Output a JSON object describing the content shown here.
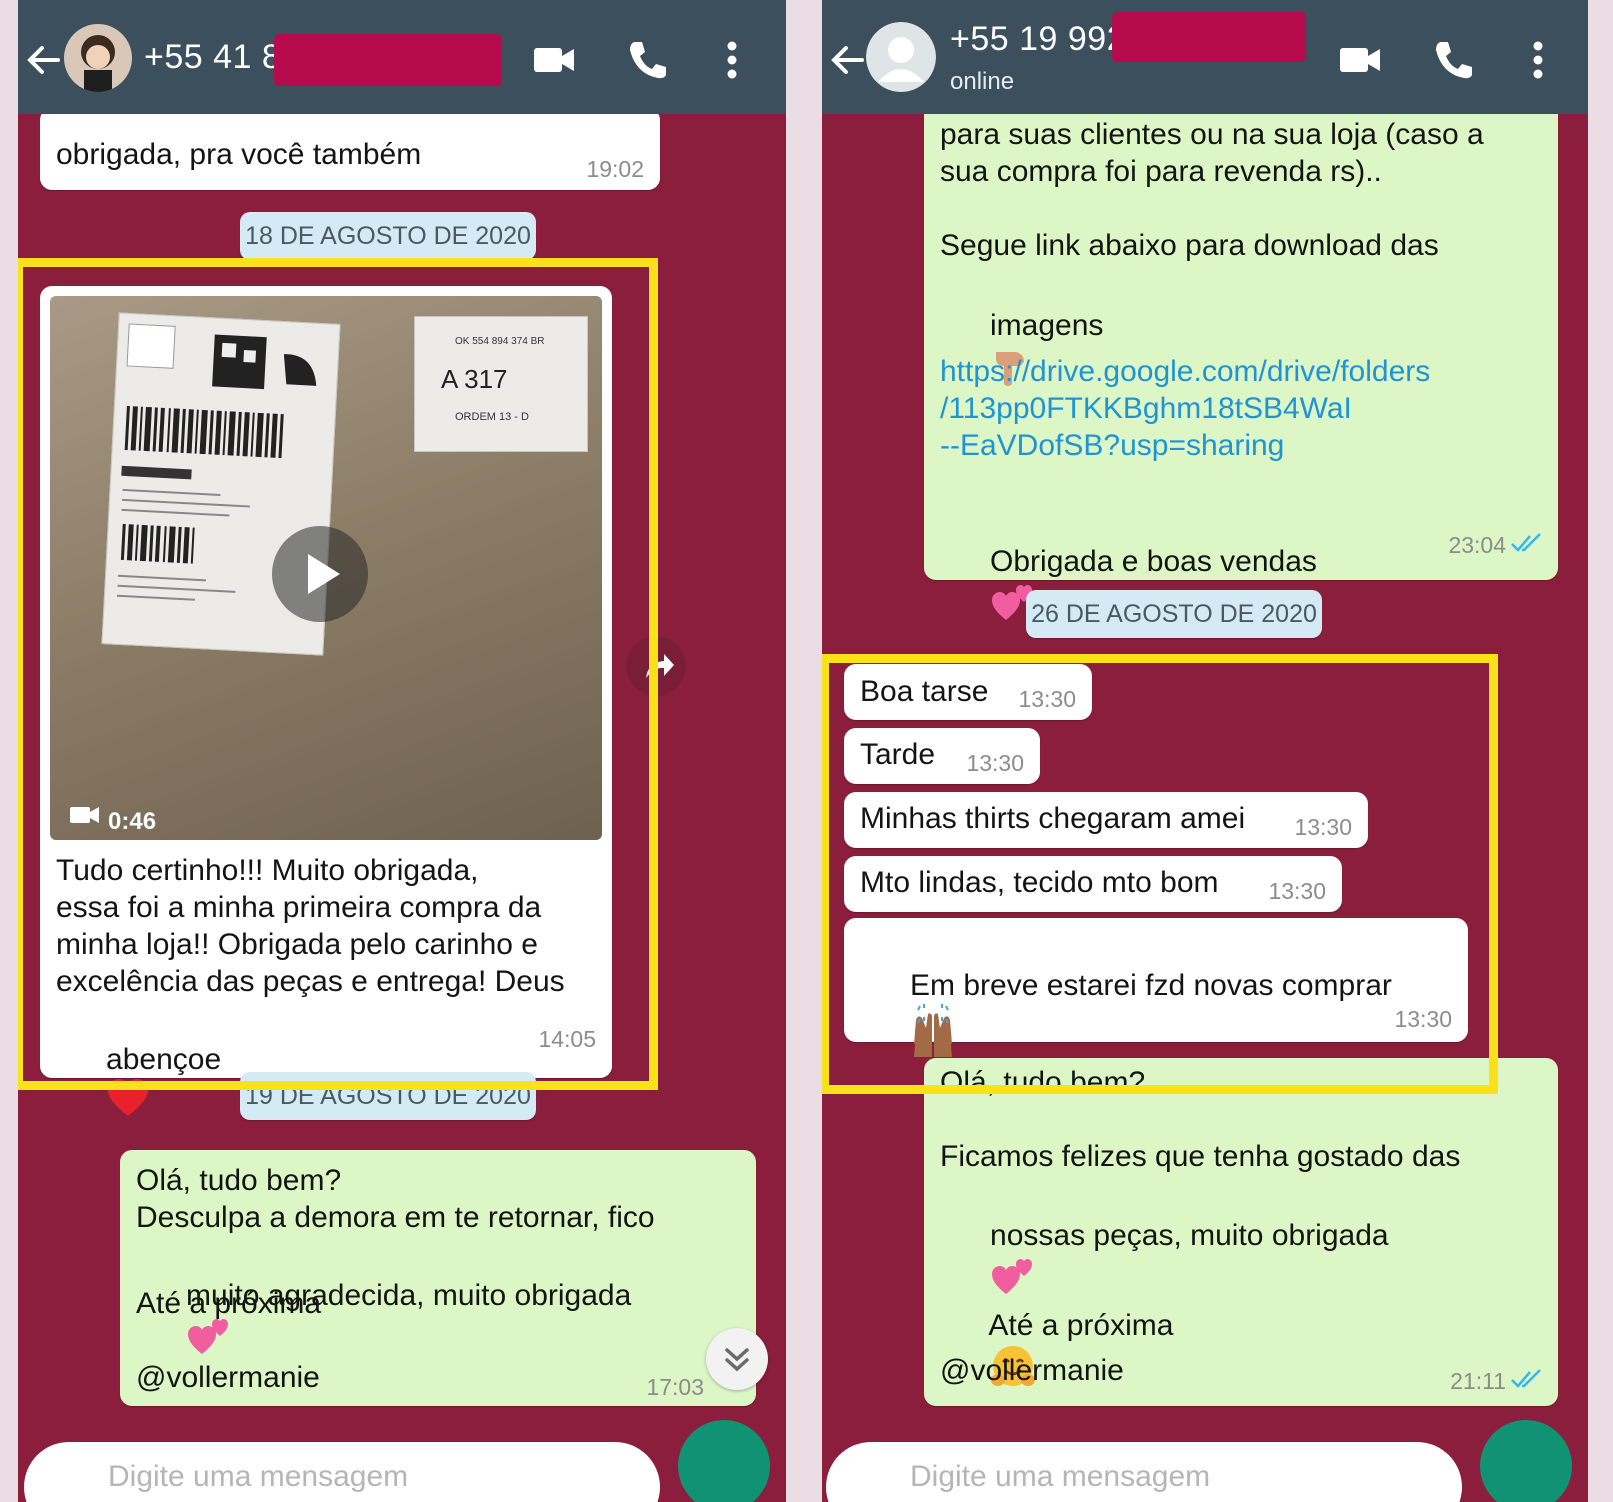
{
  "colors": {
    "chat_background": "#8b1e3c",
    "header": "#3b4f5c",
    "incoming_bubble": "#ffffff",
    "outgoing_bubble": "#dcf7c5",
    "date_pill": "#d4eaf4",
    "highlight_box": "#f9e21a",
    "redaction": "#b60c4d",
    "link": "#1f93d4",
    "mic_button": "#119273"
  },
  "left_chat": {
    "header": {
      "contact_name": "+55 41 8",
      "icons": [
        "back-arrow-icon",
        "avatar",
        "video-call-icon",
        "phone-icon",
        "more-options-icon"
      ]
    },
    "messages": {
      "m1_text": "obrigada, pra você também",
      "m1_time": "19:02",
      "date1": "18 DE AGOSTO DE 2020",
      "video_duration": "0:46",
      "video_label": {
        "a": "A   317",
        "ordem": "ORDEM  13 - D",
        "code": "OK 554 894 374 BR"
      },
      "m2_line1": "Tudo certinho!!! Muito obrigada,",
      "m2_line2": "essa foi a minha primeira compra da",
      "m2_line3": "minha loja!! Obrigada pelo carinho e",
      "m2_line4": "excelência das peças e entrega! Deus",
      "m2_line5": "abençoe",
      "m2_time": "14:05",
      "date2": "19 DE AGOSTO DE 2020",
      "m3_line1": "Olá, tudo bem?",
      "m3_line2": "Desculpa a demora em te retornar, fico",
      "m3_line3": "muito agradecida, muito obrigada",
      "m3_line4": "Até a próxima",
      "m3_line5": "@vollermanie",
      "m3_time": "17:03"
    },
    "input_placeholder": "Digite uma mensagem"
  },
  "right_chat": {
    "header": {
      "contact_name": "+55 19 992",
      "status": "online"
    },
    "messages": {
      "m1_line1": "para suas clientes ou na sua loja (caso a",
      "m1_line2": "sua compra foi para revenda rs)..",
      "m1_line3": "Segue link abaixo para download das",
      "m1_line4": "imagens",
      "m1_link1": "https://drive.google.com/drive/folders",
      "m1_link2": "/113pp0FTKKBghm18tSB4WaI",
      "m1_link3": "--EaVDofSB?usp=sharing",
      "m1_line5": "Obrigada e boas vendas",
      "m1_time": "23:04",
      "date1": "26 DE AGOSTO DE 2020",
      "r1_text": "Boa tarse",
      "r1_time": "13:30",
      "r2_text": "Tarde",
      "r2_time": "13:30",
      "r3_text": "Minhas thirts chegaram amei",
      "r3_time": "13:30",
      "r4_text": "Mto lindas, tecido mto bom",
      "r4_time": "13:30",
      "r5_text": "Em breve estarei fzd novas comprar",
      "r5_time": "13:30",
      "m2_line1": "Olá, tudo bem?",
      "m2_line2": "Ficamos felizes que tenha gostado das",
      "m2_line3": "nossas peças, muito obrigada",
      "m2_line4": "Até a próxima",
      "m2_line5": "@vollermanie",
      "m2_time": "21:11"
    },
    "input_placeholder": "Digite uma mensagem"
  }
}
